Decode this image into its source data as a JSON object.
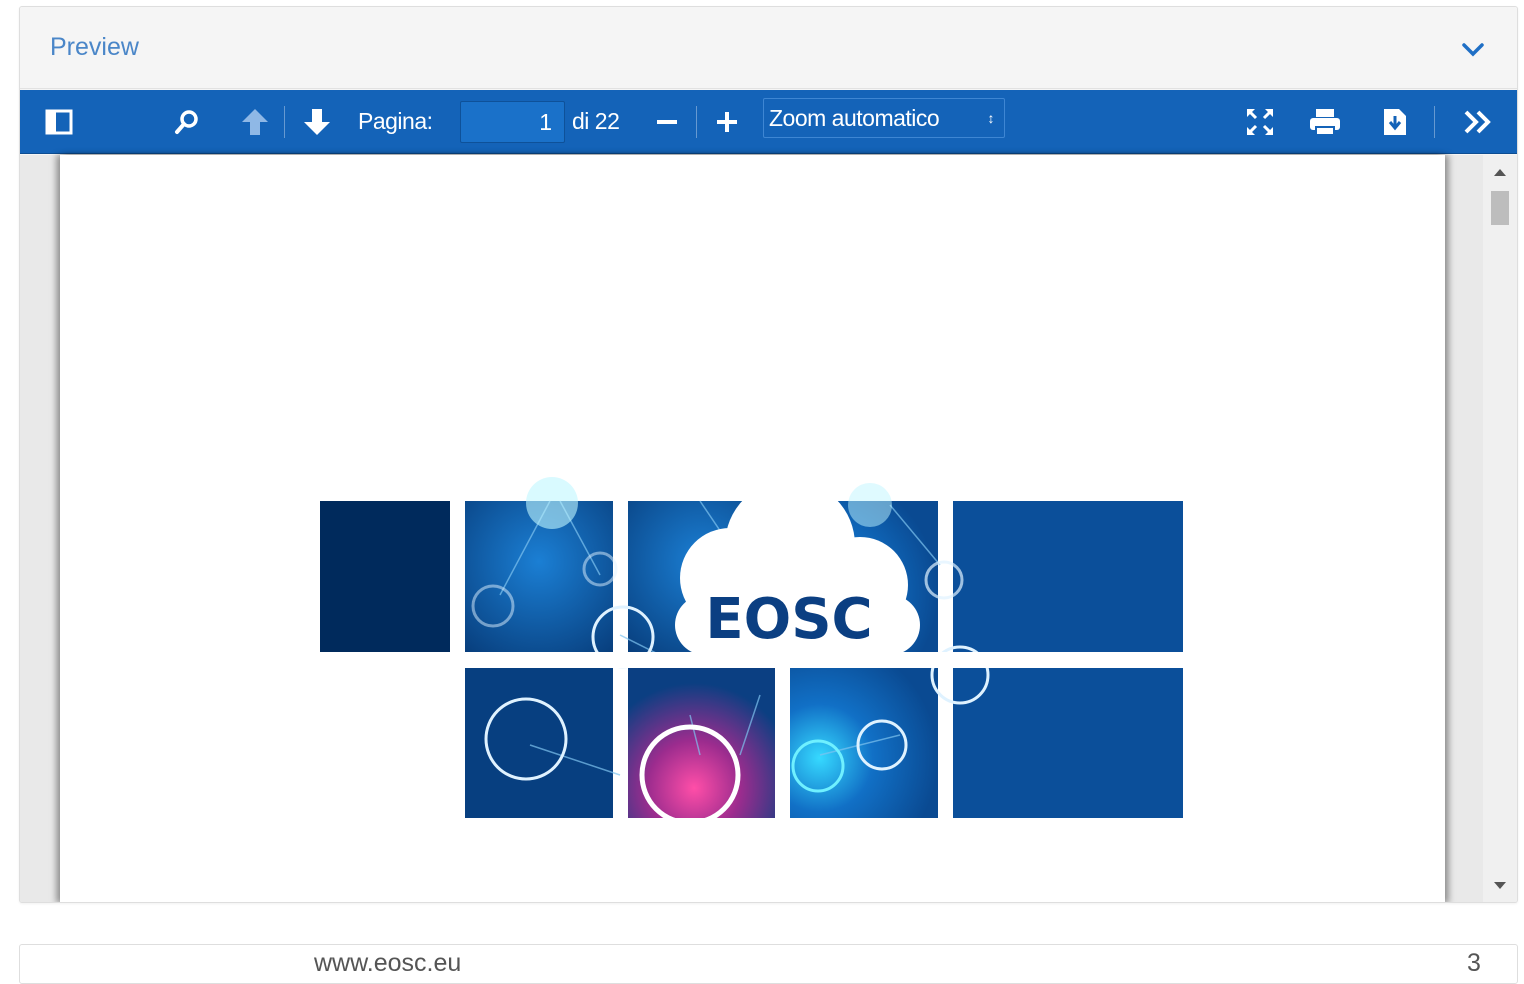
{
  "panel": {
    "title": "Preview"
  },
  "toolbar": {
    "page_label": "Pagina:",
    "page_value": "1",
    "page_total": "di 22",
    "zoom_option": "Zoom automatico",
    "icons": [
      "sidebar-toggle-icon",
      "search-icon",
      "previous-page-icon",
      "next-page-icon",
      "zoom-out-icon",
      "zoom-in-icon",
      "fullscreen-icon",
      "print-icon",
      "download-icon",
      "tools-icon"
    ]
  },
  "document": {
    "logo_text": "EOSC"
  },
  "footer": {
    "url": "www.eosc.eu",
    "page_number": "3"
  },
  "colors": {
    "toolbar": "#1463b8",
    "title": "#4a86c8",
    "tile_dark": "#002a5c",
    "tile_blue": "#0b4f9a",
    "accent_cyan": "#3fe0ff",
    "accent_pink": "#e0337f"
  }
}
